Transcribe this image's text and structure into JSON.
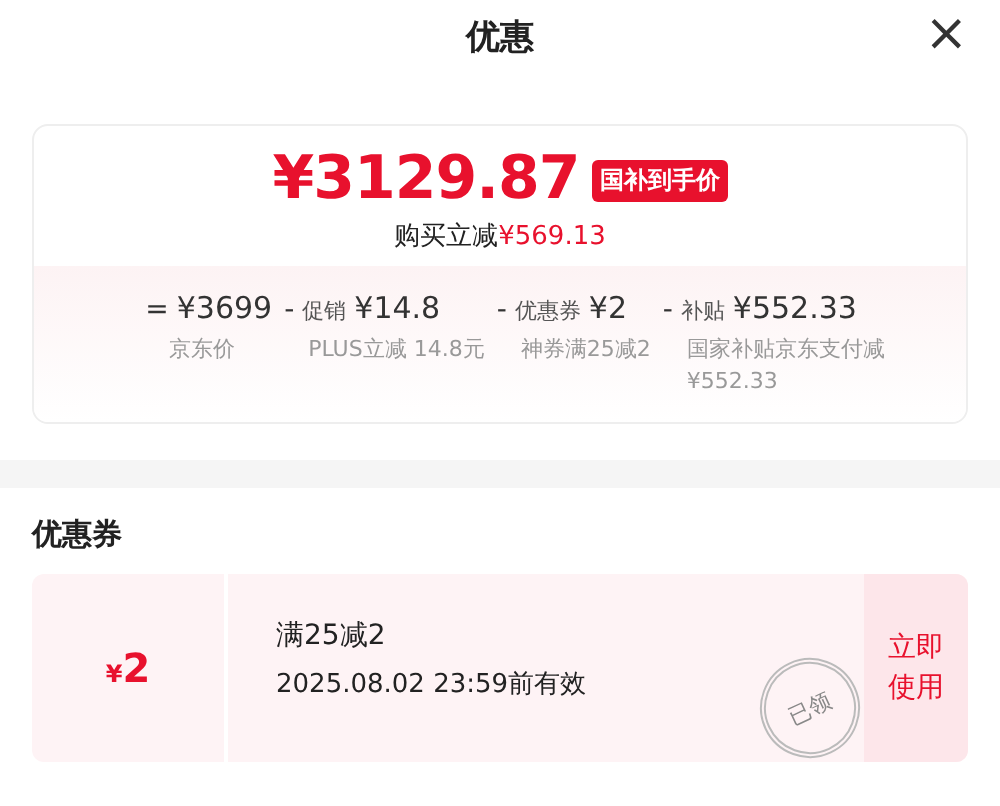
{
  "header": {
    "title": "优惠",
    "close": "×"
  },
  "price": {
    "amount": "¥3129.87",
    "tag": "国补到手价",
    "saving_label": "购买立减",
    "saving_amount": "¥569.13"
  },
  "breakdown": [
    {
      "op": "=",
      "amount": "¥3699",
      "note": "京东价"
    },
    {
      "op": "-",
      "label": "促销",
      "amount": "¥14.8",
      "note": "PLUS立减 14.8元"
    },
    {
      "op": "-",
      "label": "优惠券",
      "amount": "¥2",
      "note": "神券满25减2"
    },
    {
      "op": "-",
      "label": "补贴",
      "amount": "¥552.33",
      "note": "国家补贴京东支付减¥552.33"
    }
  ],
  "coupons_section": {
    "title": "优惠券",
    "coupons": [
      {
        "currency": "¥",
        "value": "2",
        "condition": "满25减2",
        "validity": "2025.08.02 23:59前有效",
        "stamp": "已领",
        "action": "立即使用"
      }
    ]
  }
}
